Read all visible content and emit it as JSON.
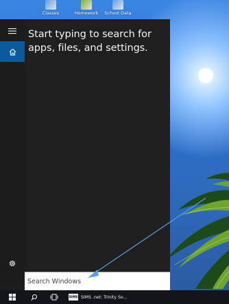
{
  "desktop": {
    "icons": [
      {
        "label": "Classes",
        "color": "#5aa0e6"
      },
      {
        "label": "Homework",
        "color": "#7fb236"
      },
      {
        "label": "School Data",
        "color": "#5aa0e6"
      }
    ]
  },
  "start_menu": {
    "hint": "Start typing to search for apps, files, and settings.",
    "rail": {
      "menu_icon": "hamburger-icon",
      "home_icon": "home-icon",
      "settings_icon": "gear-icon"
    }
  },
  "search": {
    "placeholder": "Search Windows"
  },
  "taskbar": {
    "start_icon": "windows-logo-icon",
    "search_icon": "search-icon",
    "taskview_icon": "task-view-icon",
    "apps": [
      {
        "icon_text": "SIMS",
        "label": "SIMS .net: Trinity So..."
      }
    ]
  },
  "colors": {
    "rail": "#1c1c1c",
    "panel": "#1f1f1f",
    "accent": "#0b5a9e",
    "taskbar": "#111418",
    "arrow": "#5a9ee6"
  }
}
